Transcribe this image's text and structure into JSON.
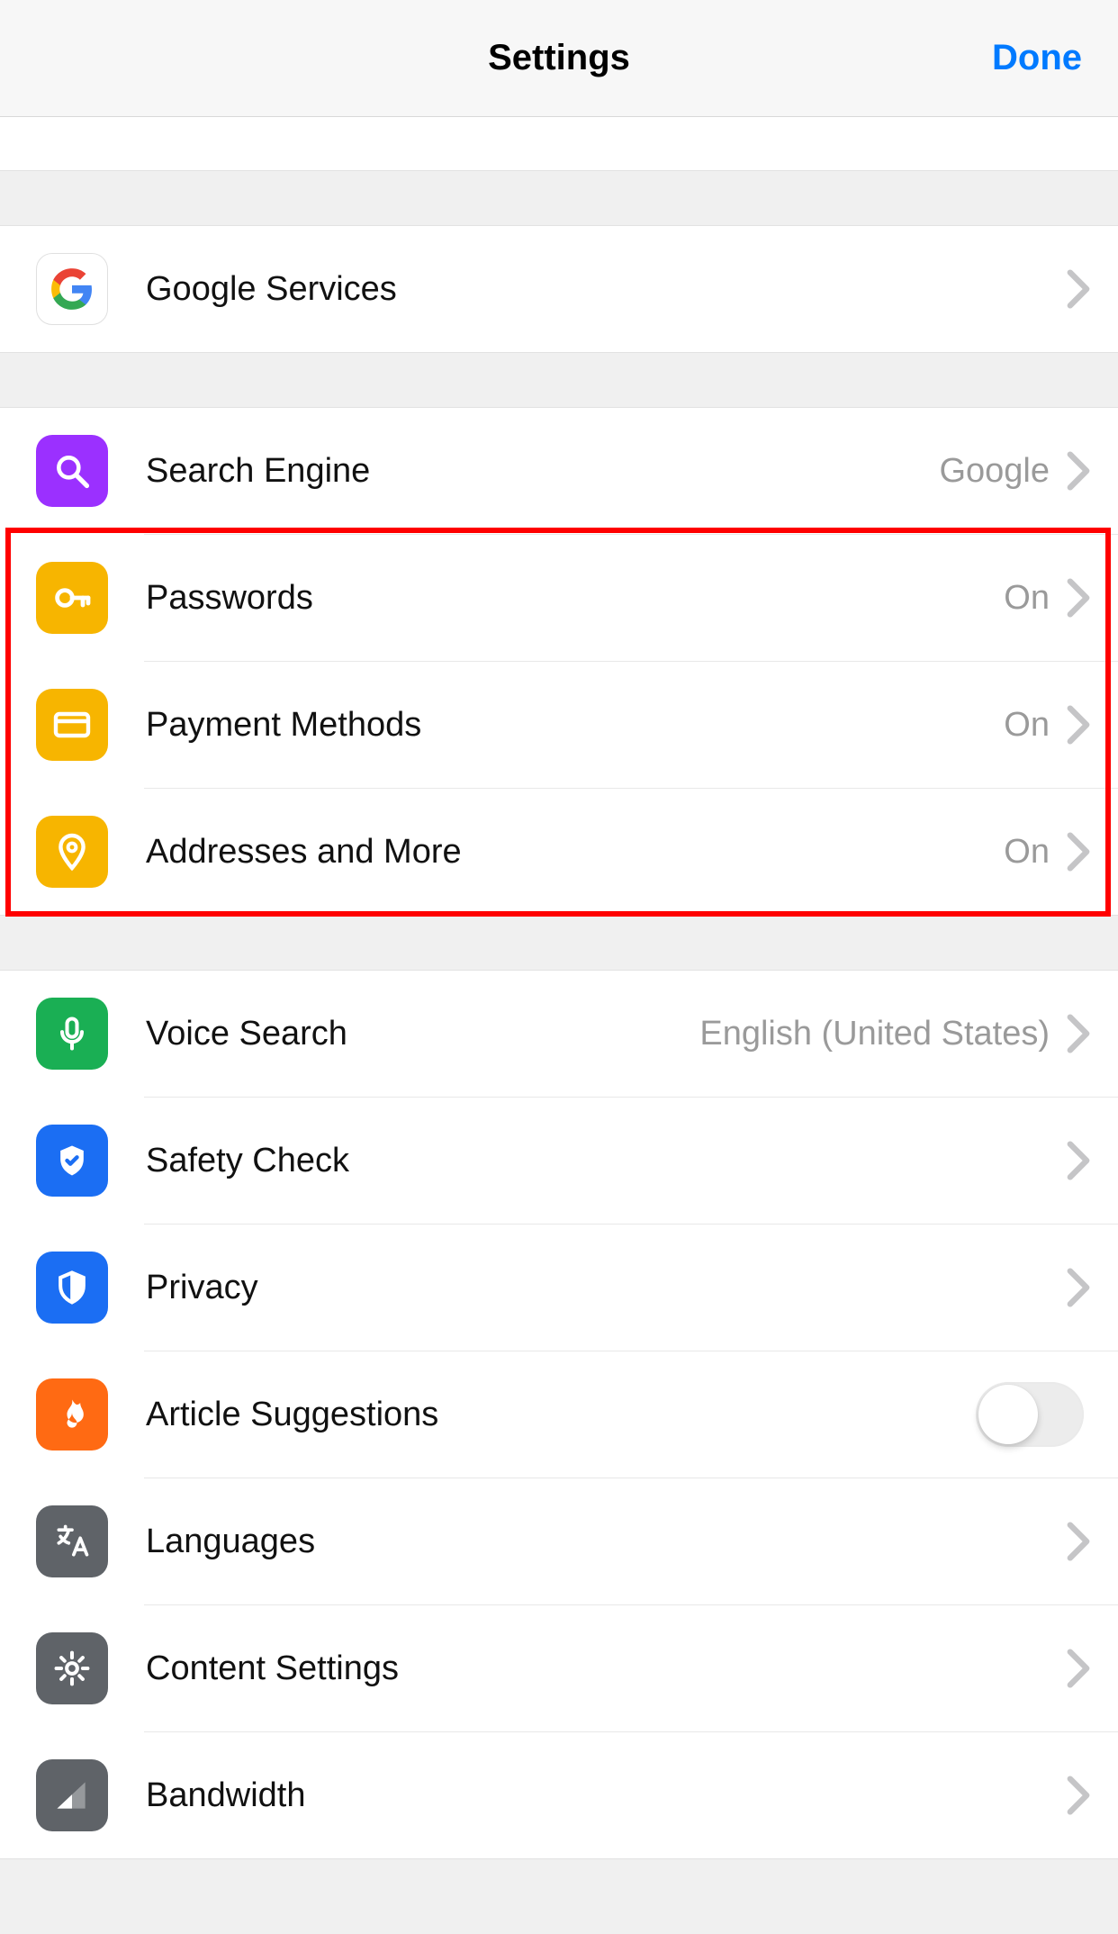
{
  "header": {
    "title": "Settings",
    "done": "Done"
  },
  "group1": {
    "google_services": {
      "label": "Google Services"
    }
  },
  "group2": {
    "search_engine": {
      "label": "Search Engine",
      "value": "Google"
    },
    "passwords": {
      "label": "Passwords",
      "value": "On"
    },
    "payment_methods": {
      "label": "Payment Methods",
      "value": "On"
    },
    "addresses": {
      "label": "Addresses and More",
      "value": "On"
    }
  },
  "group3": {
    "voice_search": {
      "label": "Voice Search",
      "value": "English (United States)"
    },
    "safety_check": {
      "label": "Safety Check"
    },
    "privacy": {
      "label": "Privacy"
    },
    "article_suggestions": {
      "label": "Article Suggestions",
      "toggle": false
    },
    "languages": {
      "label": "Languages"
    },
    "content_settings": {
      "label": "Content Settings"
    },
    "bandwidth": {
      "label": "Bandwidth"
    }
  },
  "annotation": {
    "highlight_rows": [
      "passwords",
      "payment_methods",
      "addresses"
    ]
  }
}
